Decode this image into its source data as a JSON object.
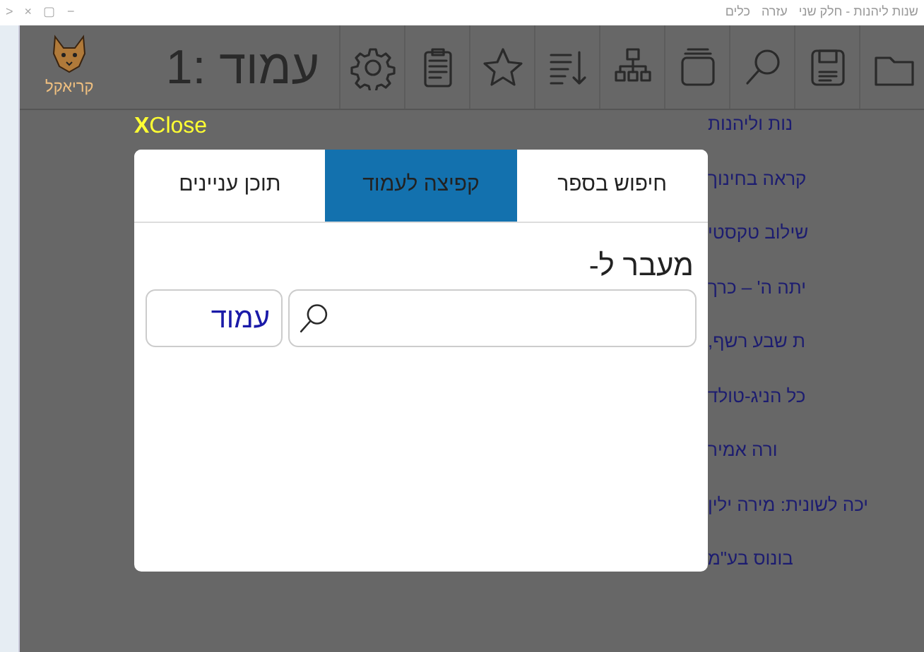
{
  "window": {
    "title": "שנות ליהנות - חלק שני",
    "controls": [
      "−",
      "▢",
      "×",
      ">"
    ],
    "menu": [
      "עזרה",
      "כלים"
    ]
  },
  "toolbar": {
    "page_label": "עמוד :1",
    "logo_text": "קריאקל"
  },
  "close_label": "Close",
  "close_mark": "X",
  "dialog": {
    "tabs": [
      {
        "label": "חיפוש בספר",
        "selected": false
      },
      {
        "label": "קפיצה לעמוד",
        "selected": true
      },
      {
        "label": "תוכן עניינים",
        "selected": false
      }
    ],
    "heading": "מעבר ל-",
    "unit_select": "עמוד"
  },
  "background_list": [
    "נות וליהנות",
    "קראה בחינוך",
    "שילוב טקסטי",
    "יתה ה' – כרך",
    "ת שבע רשף,",
    "כל הניג-טולד",
    "ורה אמיר",
    "יכה לשונית: מירה ילין",
    "בונוס בע\"מ"
  ]
}
